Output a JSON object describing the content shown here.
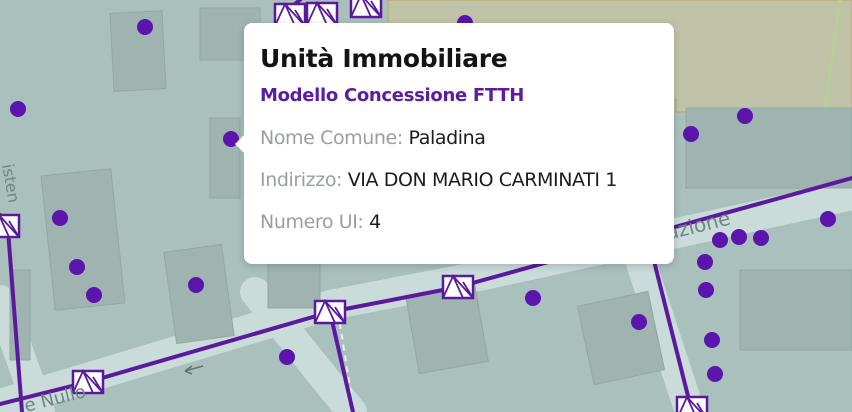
{
  "map": {
    "colors": {
      "background": "#a9c0bd",
      "block": "#9fb4b1",
      "block_border": "#92a8a4",
      "road": "#c9dcd9",
      "area_fill": "#d3c596",
      "area_border": "#bfae77",
      "network_line": "#5b1a9b",
      "point": "#5b14ac",
      "street_label": "#6f8683"
    },
    "street_labels": [
      {
        "text": "azione",
        "name": "street-label-azione"
      },
      {
        "text": "e Nullo",
        "name": "street-label-nullo"
      },
      {
        "text": "isten",
        "name": "street-label-isten"
      }
    ]
  },
  "popup": {
    "title": "Unità Immobiliare",
    "subtitle": "Modello Concessione FTTH",
    "fields": [
      {
        "label": "Nome Comune:",
        "value": "Paladina"
      },
      {
        "label": "Indirizzo:",
        "value": "VIA DON MARIO CARMINATI 1"
      },
      {
        "label": "Numero UI:",
        "value": "4"
      }
    ]
  }
}
